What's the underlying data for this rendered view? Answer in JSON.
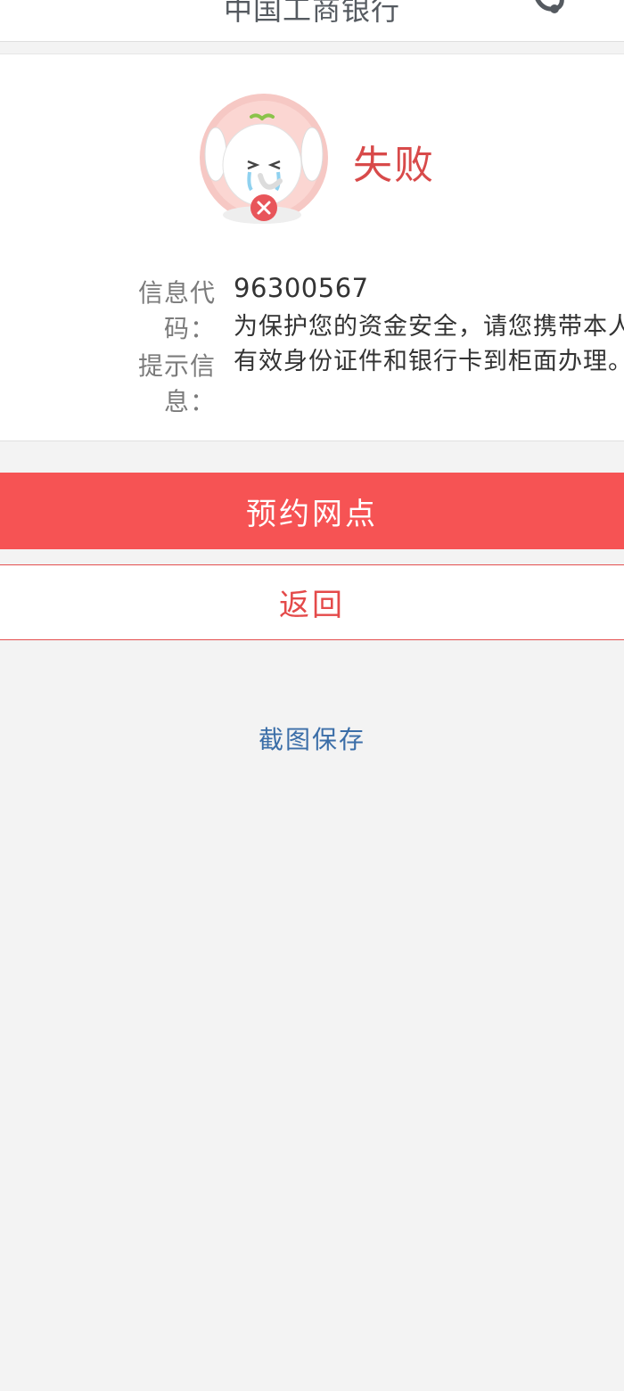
{
  "header": {
    "title": "中国工商银行",
    "service_icon": "customer-service-icon"
  },
  "result": {
    "mascot_icon": "crying-elephant-mascot-icon",
    "status_text": "失败",
    "status_color": "#d84a4a"
  },
  "info": {
    "code_label": "信息代码：",
    "code_value": "96300567",
    "tip_label": "提示信息：",
    "tip_value": "为保护您的资金安全，请您携带本人有效身份证件和银行卡到柜面办理。"
  },
  "actions": {
    "primary_label": "预约网点",
    "secondary_label": "返回",
    "screenshot_label": "截图保存"
  },
  "colors": {
    "primary": "#f65354",
    "link": "#3b6ea8",
    "background": "#f3f3f3"
  }
}
